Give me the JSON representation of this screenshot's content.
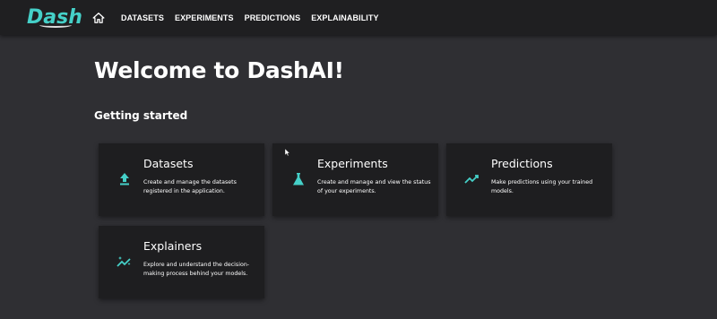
{
  "app": {
    "logo_text": "Dash"
  },
  "navbar": {
    "home_icon": "home-icon",
    "links": [
      "DATASETS",
      "EXPERIMENTS",
      "PREDICTIONS",
      "EXPLAINABILITY"
    ]
  },
  "main": {
    "title": "Welcome to DashAI!",
    "subtitle": "Getting started",
    "cards": [
      {
        "title": "Datasets",
        "description": "Create and manage the datasets registered in the application.",
        "icon": "upload-icon"
      },
      {
        "title": "Experiments",
        "description": "Create and manage and view the status of your experiments.",
        "icon": "flask-icon"
      },
      {
        "title": "Predictions",
        "description": "Make predictions using your trained models.",
        "icon": "trending-up-icon"
      },
      {
        "title": "Explainers",
        "description": "Explore and understand the decision-making process behind your models.",
        "icon": "sparkle-trend-icon"
      }
    ]
  },
  "colors": {
    "accent": "#45d0c8",
    "background": "#2f2f33",
    "navbar": "#1f1f21",
    "card": "#1e1e20"
  }
}
